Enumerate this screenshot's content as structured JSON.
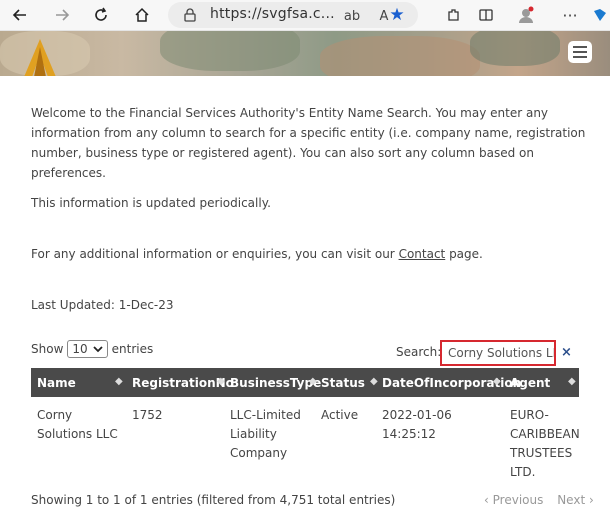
{
  "browser": {
    "url": "https://svgfsa.c..."
  },
  "intro": {
    "paragraph1": "Welcome to the Financial Services Authority's Entity Name Search. You may enter any information from any column to search for a specific entity (i.e. company name, registration number, business type or registered agent). You can also sort any column based on preferences.",
    "paragraph2": "This information is updated periodically.",
    "paragraph3_prefix": "For any additional information or enquiries, you can visit our ",
    "paragraph3_link": "Contact",
    "paragraph3_suffix": " page.",
    "last_updated": "Last Updated:  1-Dec-23"
  },
  "controls": {
    "show_label": "Show",
    "page_size": "10",
    "entries_label": "entries",
    "search_label": "Search:",
    "search_value": "Corny Solutions LLC",
    "clear_symbol": "×"
  },
  "table": {
    "columns": [
      "Name",
      "RegistrationNo",
      "BusinessType",
      "Status",
      "DateOfIncorporation",
      "Agent"
    ],
    "rows": [
      {
        "name": "Corny Solutions LLC",
        "registration_no": "1752",
        "business_type": "LLC-Limited Liability Company",
        "status": "Active",
        "date": "2022-01-06 14:25:12",
        "agent": "EURO-CARIBBEAN TRUSTEES LTD."
      }
    ]
  },
  "footer": {
    "info": "Showing 1 to 1 of 1 entries (filtered from 4,751 total entries)",
    "previous": "Previous",
    "next": "Next"
  },
  "colors": {
    "accent_red": "#d6282f",
    "header_bg": "#4a4a4a",
    "updated_red": "#c0392b"
  }
}
